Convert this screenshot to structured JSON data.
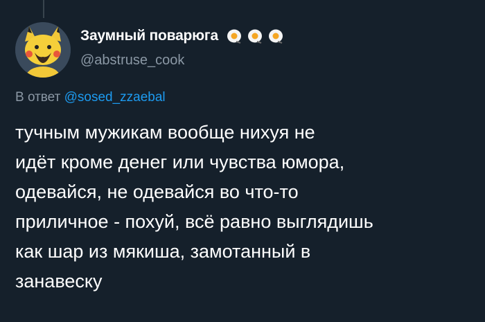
{
  "author": {
    "display_name": "Заумный поварюга",
    "handle": "@abstruse_cook",
    "badge_icons": [
      "fried-egg-icon",
      "fried-egg-icon",
      "fried-egg-icon"
    ]
  },
  "reply": {
    "prefix": "В ответ",
    "mention": "@sosed_zzaebal"
  },
  "tweet": {
    "lines": [
      "тучным мужикам вообще нихуя не",
      "идёт кроме денег или чувства юмора,",
      "одевайся, не одевайся во что-то",
      "приличное - похуй, всё равно выглядишь",
      "как шар из мякиша, замотанный в",
      "занавеску"
    ]
  },
  "colors": {
    "background": "#15202b",
    "secondary_text": "#8b98a5",
    "link": "#1d9bf0"
  }
}
